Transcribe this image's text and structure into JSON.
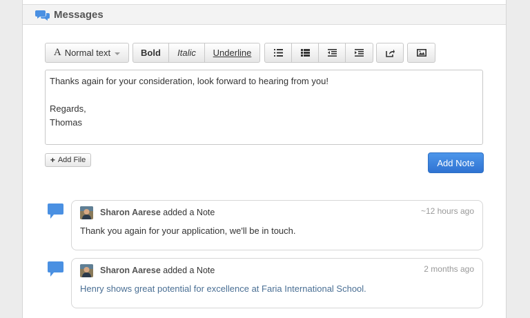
{
  "header": {
    "title": "Messages",
    "icon": "chat-bubbles-icon"
  },
  "toolbar": {
    "font_label": "Normal text",
    "font_glyph": "A",
    "bold_label": "Bold",
    "italic_label": "Italic",
    "underline_label": "Underline",
    "icons": [
      "unordered-list-icon",
      "ordered-list-icon",
      "outdent-icon",
      "indent-icon",
      "link-share-icon",
      "image-icon"
    ]
  },
  "editor": {
    "lines": [
      "Thanks again for your consideration, look forward to hearing from you!",
      "",
      "Regards,",
      "Thomas"
    ]
  },
  "actions": {
    "add_file_label": "Add File",
    "add_note_label": "Add Note"
  },
  "notes": [
    {
      "author": "Sharon Aarese",
      "action": "added a Note",
      "time": "~12 hours ago",
      "body": "Thank you again for your application, we'll be in touch.",
      "body_color": "#333333"
    },
    {
      "author": "Sharon Aarese",
      "action": "added a Note",
      "time": "2 months ago",
      "body": "Henry shows great potential for excellence at Faria International School.",
      "body_color": "#4a6f94"
    }
  ],
  "colors": {
    "primary": "#3a82df",
    "bubble": "#4a90e2"
  }
}
